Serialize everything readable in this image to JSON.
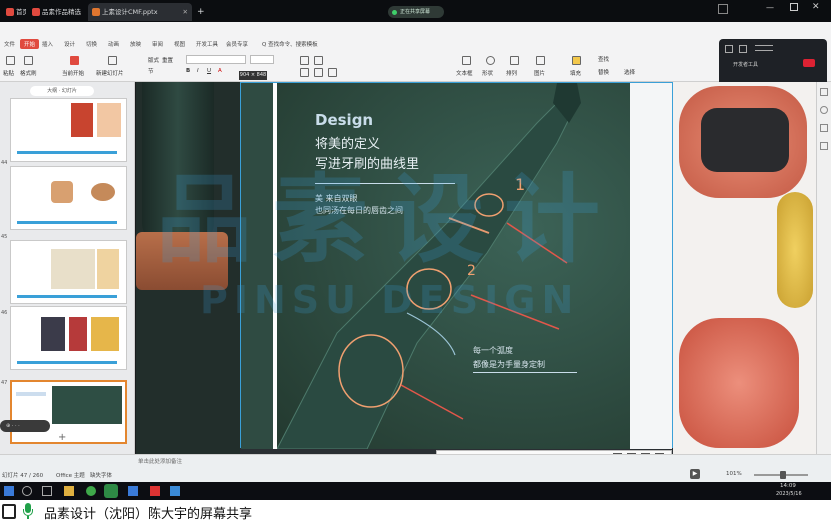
{
  "tabs": [
    {
      "label": "首页",
      "color": "#e04a3f"
    },
    {
      "label": "品素作品精选",
      "color": "#e04a3f"
    },
    {
      "label": "上素设计CMF.pptx",
      "color": "#e0762f"
    },
    {
      "label": "+",
      "color": ""
    }
  ],
  "share_notice": "正在共享屏幕",
  "menu": [
    "文件",
    "开始",
    "插入",
    "设计",
    "切换",
    "动画",
    "放映",
    "审阅",
    "视图",
    "开发工具",
    "会员专享",
    "Q 查找命令、搜索模板"
  ],
  "menu_active_index": 1,
  "ribbon": {
    "paste": "粘贴",
    "format_brush": "格式刷",
    "from_current": "当前开始",
    "new_slide": "新建幻灯片",
    "layout": "版式",
    "section": "节",
    "reset": "重置",
    "textbox": "文本框",
    "shape": "形状",
    "arrange": "排列",
    "picture": "图片",
    "fill": "填充",
    "find": "查找",
    "replace": "替换",
    "select": "选择"
  },
  "share_panel": {
    "label": "开发者工具"
  },
  "size_badge": "904 × 848",
  "slide": {
    "heading_en": "Design",
    "heading_cn1": "将美的定义",
    "heading_cn2": "写进牙刷的曲线里",
    "sub1": "美 来自双眼",
    "sub2": "也同汤在每日的唇齿之间",
    "note1": "每一个弧度",
    "note2": "都像是为手量身定制",
    "mark1": "1",
    "mark2": "2"
  },
  "watermark_top": "品素设计",
  "watermark_bottom": "PINSU DESIGN",
  "thumb_numbers": [
    "",
    "44",
    "45",
    "46",
    "47"
  ],
  "status": {
    "slide_info": "幻灯片 47 / 260",
    "theme": "Office 主题",
    "font": "缺失字体",
    "notes": "单击此处添加备注",
    "zoom": "101%"
  },
  "annotation_colors": [
    "#000000",
    "#ff0000",
    "#ff8800",
    "#ffff00",
    "#00aa00",
    "#00ffff",
    "#0000ff",
    "#ff00ff",
    "#ffffff",
    "#888888",
    "#ff9999",
    "#99ccff"
  ],
  "taskbar": {
    "time": "14:09",
    "date": "2023/5/16"
  },
  "share_bar": {
    "label": "品素设计（沈阳）陈大宇的屏幕共享"
  },
  "colors": {
    "accent": "#e04a3f",
    "slide_bg": "#2e4e44",
    "marker": "#f0a070",
    "selection": "#3aa0d8"
  }
}
